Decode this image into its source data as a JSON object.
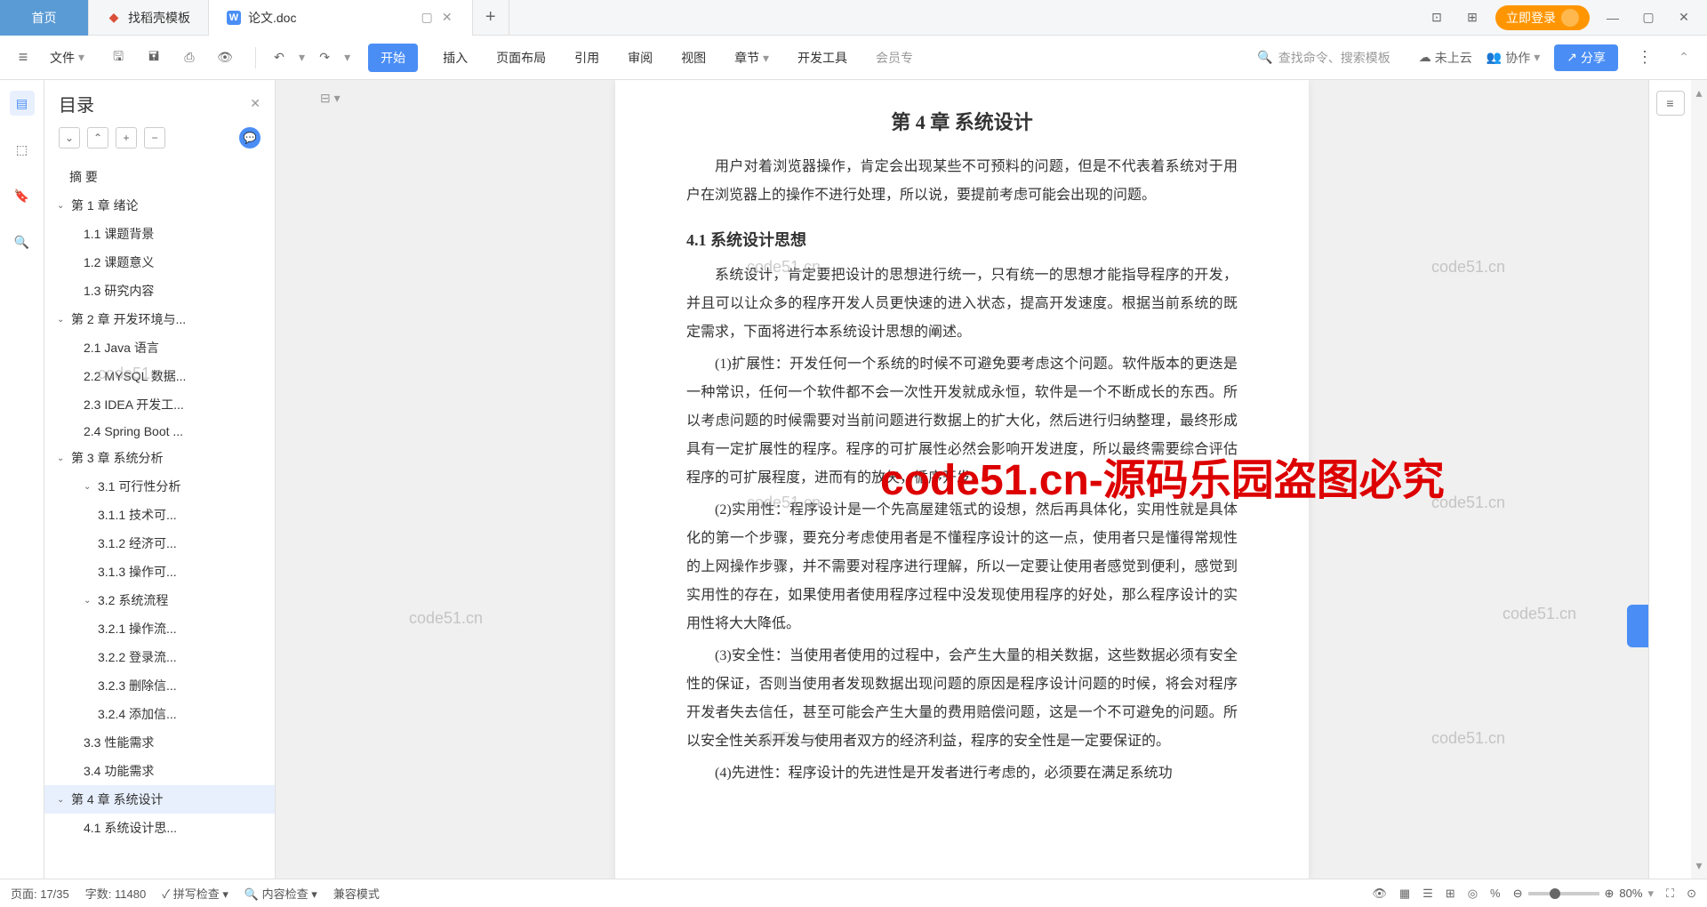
{
  "tabs": {
    "home": "首页",
    "template": "找稻壳模板",
    "doc": "论文.doc",
    "login": "立即登录"
  },
  "toolbar": {
    "file": "文件",
    "undo": "↶",
    "redo": "↷"
  },
  "menus": {
    "start": "开始",
    "insert": "插入",
    "layout": "页面布局",
    "reference": "引用",
    "review": "审阅",
    "view": "视图",
    "section": "章节",
    "dev": "开发工具",
    "member": "会员专"
  },
  "search": {
    "placeholder": "查找命令、搜索模板"
  },
  "right": {
    "cloud": "未上云",
    "collab": "协作",
    "share": "分享"
  },
  "outline": {
    "title": "目录",
    "items": [
      {
        "t": "摘  要",
        "l": 0
      },
      {
        "t": "第 1 章  绪论",
        "l": 1,
        "c": true
      },
      {
        "t": "1.1 课题背景",
        "l": 2
      },
      {
        "t": "1.2 课题意义",
        "l": 2
      },
      {
        "t": "1.3 研究内容",
        "l": 2
      },
      {
        "t": "第 2 章 开发环境与...",
        "l": 1,
        "c": true
      },
      {
        "t": "2.1 Java 语言",
        "l": 2
      },
      {
        "t": "2.2 MYSQL 数据...",
        "l": 2
      },
      {
        "t": "2.3 IDEA 开发工...",
        "l": 2
      },
      {
        "t": "2.4 Spring Boot ...",
        "l": 2
      },
      {
        "t": "第 3 章  系统分析",
        "l": 1,
        "c": true
      },
      {
        "t": "3.1 可行性分析",
        "l": 2,
        "c": true
      },
      {
        "t": "3.1.1  技术可...",
        "l": 3
      },
      {
        "t": "3.1.2  经济可...",
        "l": 3
      },
      {
        "t": "3.1.3  操作可...",
        "l": 3
      },
      {
        "t": "3.2  系统流程",
        "l": 2,
        "c": true
      },
      {
        "t": "3.2.1  操作流...",
        "l": 3
      },
      {
        "t": "3.2.2  登录流...",
        "l": 3
      },
      {
        "t": "3.2.3  删除信...",
        "l": 3
      },
      {
        "t": "3.2.4  添加信...",
        "l": 3
      },
      {
        "t": "3.3 性能需求",
        "l": 2
      },
      {
        "t": "3.4 功能需求",
        "l": 2
      },
      {
        "t": "第 4 章  系统设计",
        "l": 1,
        "c": true,
        "sel": true
      },
      {
        "t": "4.1  系统设计思...",
        "l": 2
      }
    ]
  },
  "doc": {
    "title": "第 4 章  系统设计",
    "intro": "用户对着浏览器操作，肯定会出现某些不可预料的问题，但是不代表着系统对于用户在浏览器上的操作不进行处理，所以说，要提前考虑可能会出现的问题。",
    "sec": "4.1  系统设计思想",
    "p1": "系统设计，肯定要把设计的思想进行统一，只有统一的思想才能指导程序的开发，并且可以让众多的程序开发人员更快速的进入状态，提高开发速度。根据当前系统的既定需求，下面将进行本系统设计思想的阐述。",
    "p2": "(1)扩展性：开发任何一个系统的时候不可避免要考虑这个问题。软件版本的更迭是一种常识，任何一个软件都不会一次性开发就成永恒，软件是一个不断成长的东西。所以考虑问题的时候需要对当前问题进行数据上的扩大化，然后进行归纳整理，最终形成具有一定扩展性的程序。程序的可扩展性必然会影响开发进度，所以最终需要综合评估程序的可扩展程度，进而有的放矢，循序开发。",
    "p3": "(2)实用性：程序设计是一个先高屋建瓴式的设想，然后再具体化，实用性就是具体化的第一个步骤，要充分考虑使用者是不懂程序设计的这一点，使用者只是懂得常规性的上网操作步骤，并不需要对程序进行理解，所以一定要让使用者感觉到便利，感觉到实用性的存在，如果使用者使用程序过程中没发现使用程序的好处，那么程序设计的实用性将大大降低。",
    "p4": "(3)安全性：当使用者使用的过程中，会产生大量的相关数据，这些数据必须有安全性的保证，否则当使用者发现数据出现问题的原因是程序设计问题的时候，将会对程序开发者失去信任，甚至可能会产生大量的费用赔偿问题，这是一个不可避免的问题。所以安全性关系开发与使用者双方的经济利益，程序的安全性是一定要保证的。",
    "p5": "(4)先进性：程序设计的先进性是开发者进行考虑的，必须要在满足系统功"
  },
  "wm": "code51.cn",
  "bigwm": "code51.cn-源码乐园盗图必究",
  "status": {
    "page": "页面: 17/35",
    "words": "字数: 11480",
    "spell": "拼写检查",
    "content": "内容检查",
    "compat": "兼容模式",
    "zoom": "80%"
  }
}
